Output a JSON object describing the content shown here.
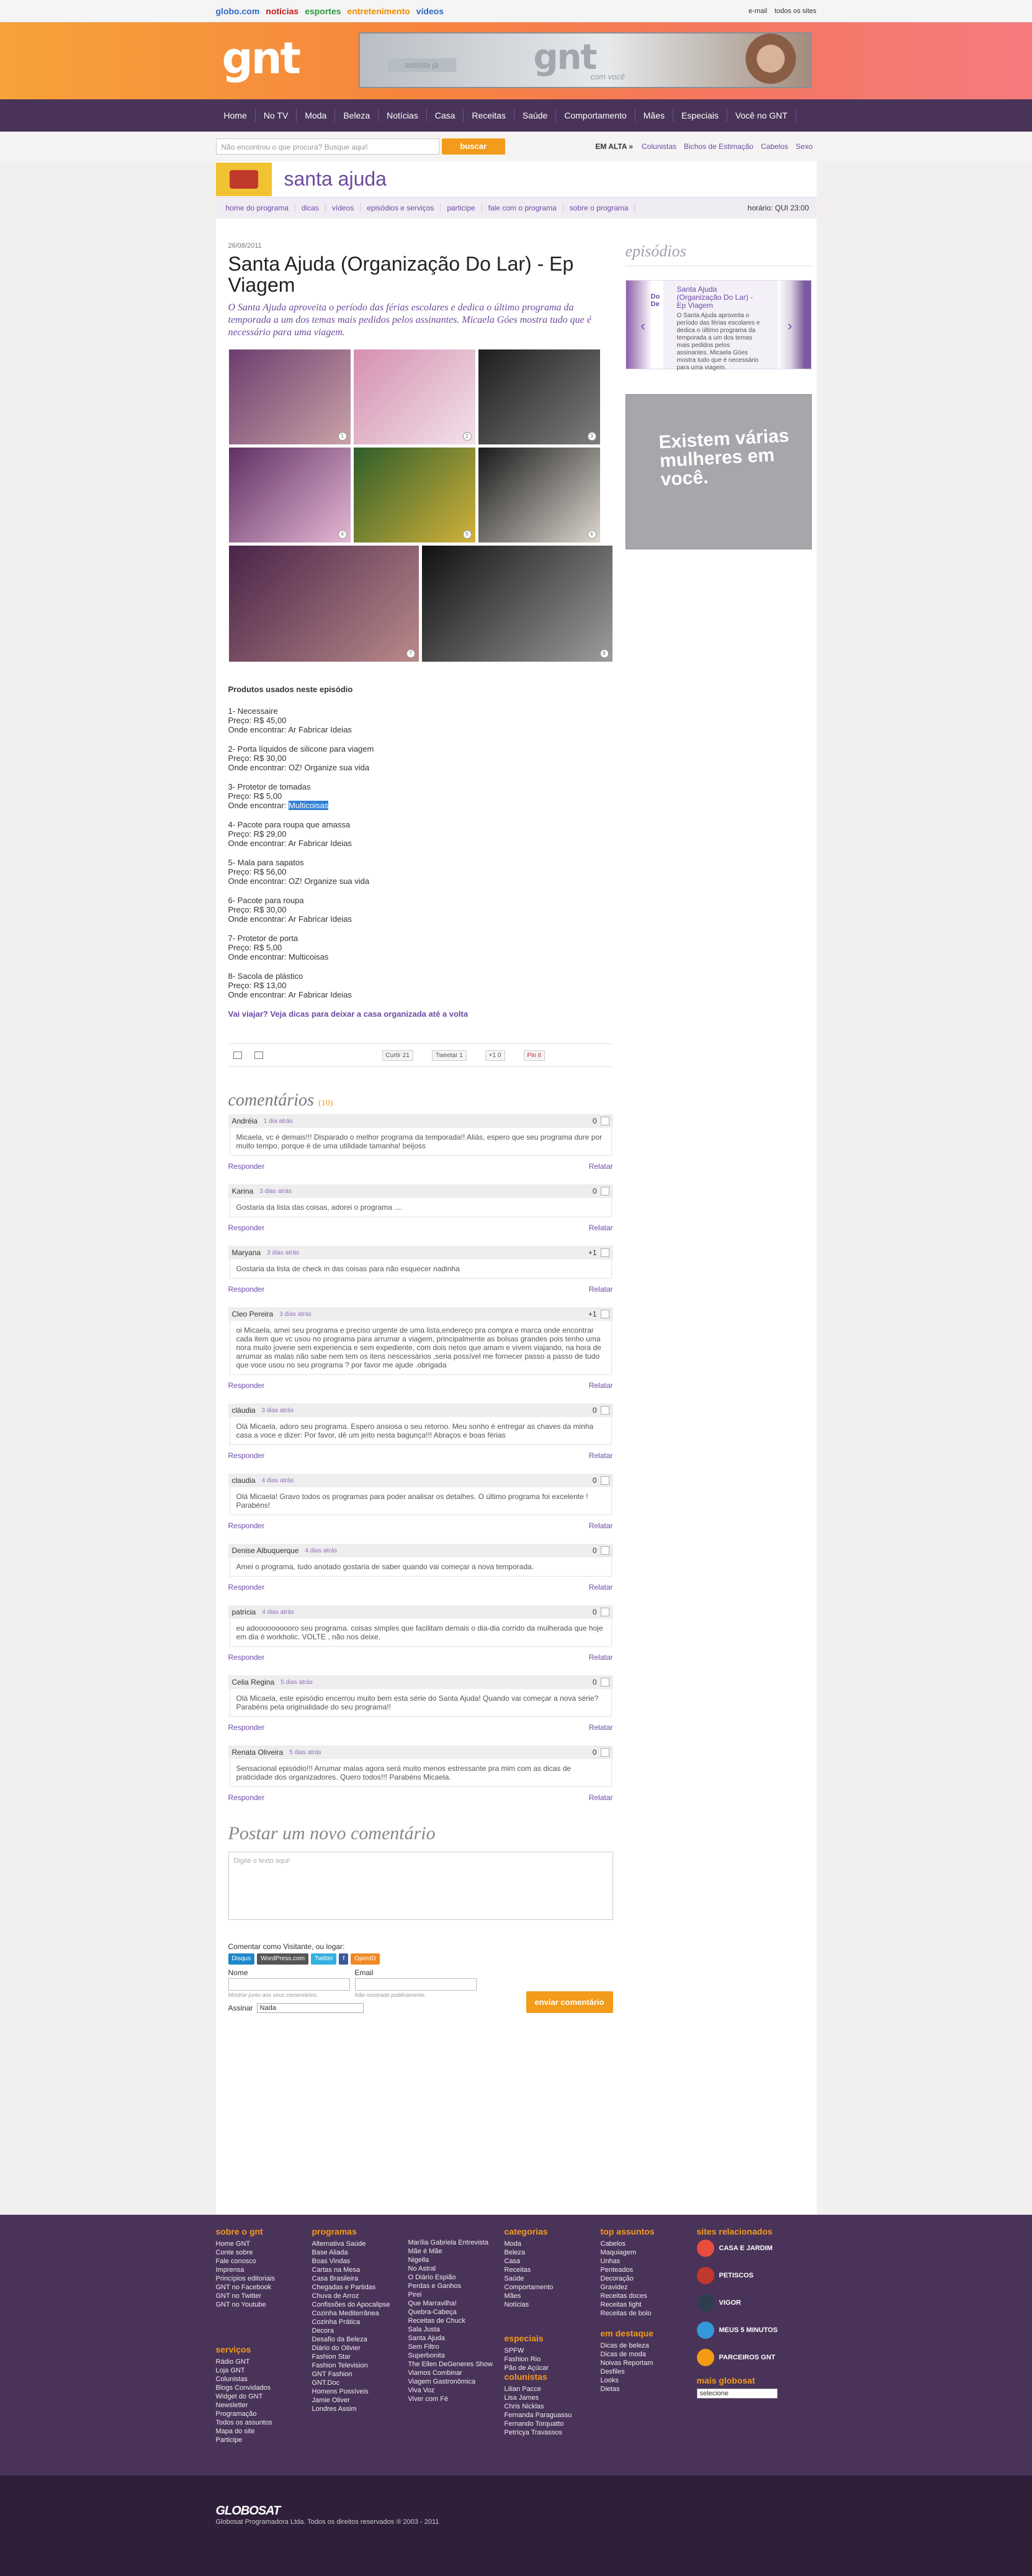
{
  "topbar": {
    "links": [
      "globo.com",
      "notícias",
      "esportes",
      "entretenimento",
      "vídeos"
    ],
    "colors": [
      "#2d69c8",
      "#c41a1a",
      "#2a9a3a",
      "#f08a00",
      "#2d69c8"
    ],
    "email": "e-mail",
    "todos": "todos os sites"
  },
  "header": {
    "logo": "gnt",
    "banner_label": "assista já",
    "banner_logo": "gnt",
    "banner_sub": "com você"
  },
  "nav": [
    "Home",
    "No TV",
    "Moda",
    "Beleza",
    "Notícias",
    "Casa",
    "Receitas",
    "Saúde",
    "Comportamento",
    "Mães",
    "Especiais",
    "Você no GNT"
  ],
  "search": {
    "placeholder": "Não encontrou o que procura? Busque aqui!",
    "button": "buscar",
    "emalta": "EM ALTA »",
    "links": [
      "Colunistas",
      "Bichos de Estimação",
      "Cabelos",
      "Sexo"
    ]
  },
  "program": {
    "title": "santa ajuda",
    "subnav": [
      "home do programa",
      "dicas",
      "vídeos",
      "episódios e serviços",
      "participe",
      "fale com o programa",
      "sobre o programa"
    ],
    "horario": "horário: QUI 23:00"
  },
  "article": {
    "date": "26/08/2011",
    "title": "Santa Ajuda (Organização Do Lar) - Ep Viagem",
    "lead": "O Santa Ajuda aproveita o período das férias escolares e dedica o último programa da temporada a um dos temas mais pedidos pelos assinantes. Micaela Góes mostra tudo que é necessário para uma viagem."
  },
  "photos": [
    "1",
    "2",
    "3",
    "4",
    "5",
    "6",
    "7",
    "8"
  ],
  "products": {
    "title": "Produtos usados neste episódio",
    "items": [
      {
        "name": "1- Necessaire",
        "price": "Preço: R$ 45,00",
        "where": "Onde encontrar: Ar Fabricar Ideias"
      },
      {
        "name": "2- Porta líquidos de silicone para viagem",
        "price": "Preço: R$ 30,00",
        "where": "Onde encontrar: OZ! Organize sua vida"
      },
      {
        "name": "3- Protetor de tomadas",
        "price": "Preço: R$ 5,00",
        "where": "Onde encontrar: ",
        "hl": "Multicoisas"
      },
      {
        "name": "4- Pacote para roupa que amassa",
        "price": "Preço: R$ 29,00",
        "where": "Onde encontrar: Ar Fabricar Ideias"
      },
      {
        "name": "5- Mala para sapatos",
        "price": "Preço: R$ 56,00",
        "where": "Onde encontrar: OZ! Organize sua vida"
      },
      {
        "name": "6- Pacote para roupa",
        "price": "Preço: R$ 30,00",
        "where": "Onde encontrar: Ar Fabricar Ideias"
      },
      {
        "name": "7- Protetor de porta",
        "price": "Preço: R$ 5,00",
        "where": "Onde encontrar: Multicoisas"
      },
      {
        "name": "8- Sacola de plástico",
        "price": "Preço: R$ 13,00",
        "where": "Onde encontrar: Ar Fabricar Ideias"
      }
    ],
    "travel": "Vai viajar? Veja dicas para deixar a casa organizada até a volta"
  },
  "share": {
    "curtir": "Curtir",
    "curtir_n": "21",
    "tweet": "Tweetar",
    "tweet_n": "1",
    "plus": "+1",
    "plus_n": "0",
    "pin": "Pin it"
  },
  "comments": {
    "title": "comentários",
    "count": "(10)",
    "reply": "Responder",
    "report": "Relatar",
    "items": [
      {
        "user": "Andréia",
        "time": "1 dia atrás",
        "score": "0",
        "text": "Micaela, vc é demais!!! Disparado o melhor programa da temporada!! Aliás, espero que seu programa dure por muito tempo, porque é de uma utilidade tamanha! beijoss"
      },
      {
        "user": "Karina",
        "time": "3 dias atrás",
        "score": "0",
        "text": "Gostaria da lista das coisas, adorei o programa ...."
      },
      {
        "user": "Maryana",
        "time": "3 dias atrás",
        "score": "+1",
        "text": "Gostaria da lista de check in das coisas para não esquecer nadinha"
      },
      {
        "user": "Cleo Pereira",
        "time": "3 dias atrás",
        "score": "+1",
        "text": "oi Micaela, amei seu programa e preciso urgente de uma lista,endereço pra compra e marca onde encontrar cada item que vc usou no programa para arrumar a viagem, principalmente as bolsas grandes pois tenho uma nora muito jovene sem experiencia e sem expediente, com dois netos que amam e vivem viajando, na hora de arrumar as malas não sabe nem tem os itens nescessários ,seria possível me fornecer passo a passo de tudo que voce usou no seu programa ? por favor me ajude .obrigada"
      },
      {
        "user": "cláudia",
        "time": "3 dias atrás",
        "score": "0",
        "text": "Olá Micaela, adoro seu programa. Espero ansiosa o seu retorno. Meu sonho é entregar as chaves da minha casa a voce e dizer: Por favor, dê um jeito nesta bagunça!!! Abraços e boas férias"
      },
      {
        "user": "claudia",
        "time": "4 dias atrás",
        "score": "0",
        "text": "Olá Micaela! Gravo todos os programas para poder analisar os detalhes. O último programa foi excelente ! Parabéns!"
      },
      {
        "user": "Denise Albuquerque",
        "time": "4 dias atrás",
        "score": "0",
        "text": "Amei o programa, tudo anotado gostaria de saber quando vai começar a nova temporada."
      },
      {
        "user": "patricia",
        "time": "4 dias atrás",
        "score": "0",
        "text": "eu adoooooooooro seu programa. coisas simples que facilitam demais o dia-dia corrido da mulherada que hoje em dia é workholic. VOLTE , não nos deixe."
      },
      {
        "user": "Celia Regina",
        "time": "5 dias atrás",
        "score": "0",
        "text": "Olá Micaela, este episódio encerrou muito bem esta série do Santa Ajuda! Quando vai começar a nova série? Parabéns pela originalidade do seu programa!!"
      },
      {
        "user": "Renata Oliveira",
        "time": "5 dias atrás",
        "score": "0",
        "text": "Sensacional episódio!!! Arrumar malas agora será muito menos estressante pra mim com as dicas de praticidade dos organizadores. Quero todos!!! Parabéns Micaela."
      }
    ]
  },
  "form": {
    "title": "Postar um novo comentário",
    "placeholder": "Digite o texto aqui!",
    "ident": "Comentar como Visitante, ou logar:",
    "services": [
      "Disqus",
      "WordPress.com",
      "Twitter",
      "f",
      "OpenID"
    ],
    "nome": "Nome",
    "nome_h": "Mostrar junto aos seus comentários.",
    "email": "Email",
    "email_h": "Não mostrado publicamente.",
    "assinar": "Assinar",
    "assinar_val": "Nada",
    "send": "enviar comentário"
  },
  "sidebar": {
    "episodios": "episódios",
    "ep_title": "Santa Ajuda (Organização Do Lar) - Ep Viagem",
    "ep_text": "O Santa Ajuda aproveita o período das férias escolares e dedica o último programa da temporada a um dos temas mais pedidos pelos assinantes. Micaela Góes mostra tudo que é necessário para uma viagem.",
    "ep_prev": "Do De",
    "ad": "Existem várias mulheres em você."
  },
  "footer": {
    "sobre": {
      "title": "sobre o gnt",
      "items": [
        "Home GNT",
        "Conte sobre",
        "Fale conosco",
        "Imprensa",
        "Princípios editoriais",
        "GNT no Facebook",
        "GNT no Twitter",
        "GNT no Youtube"
      ]
    },
    "servicos": {
      "title": "serviços",
      "items": [
        "Rádio GNT",
        "Loja GNT",
        "Colunistas",
        "Blogs Convidados",
        "Widget do GNT",
        "Newsletter",
        "Programação",
        "Todos os assuntos",
        "Mapa do site",
        "Participe"
      ]
    },
    "programas": {
      "title": "programas",
      "items": [
        "Alternativa Saúde",
        "Base Aliada",
        "Boas Vindas",
        "Cartas na Mesa",
        "Casa Brasileira",
        "Chegadas e Partidas",
        "Chuva de Arroz",
        "Confissões do Apocalipse",
        "Cozinha Mediterrânea",
        "Cozinha Prática",
        "Decora",
        "Desafio da Beleza",
        "Diário do Olivier",
        "Fashion Star",
        "Fashion Television",
        "GNT Fashion",
        "GNT.Doc",
        "Homens Possíveis",
        "Jamie Oliver",
        "Londres Assim"
      ]
    },
    "programas2": {
      "items": [
        "Marília Gabriela Entrevista",
        "Mãe é Mãe",
        "Nigella",
        "No Astral",
        "O Diário Espião",
        "Perdas e Ganhos",
        "Pirei",
        "Que Marravilha!",
        "Quebra-Cabeça",
        "Receitas de Chuck",
        "Sala Justa",
        "Santa Ajuda",
        "Sem Filtro",
        "Superbonita",
        "The Ellen DeGeneres Show",
        "Viamos Combinar",
        "Viagem Gastronômica",
        "Viva Voz",
        "Viver com Fé"
      ]
    },
    "categorias": {
      "title": "categorias",
      "items": [
        "Moda",
        "Beleza",
        "Casa",
        "Receitas",
        "Saúde",
        "Comportamento",
        "Mães",
        "Notícias"
      ]
    },
    "especiais": {
      "title": "especiais",
      "items": [
        "SPFW",
        "Fashion Rio",
        "Pão de Açúcar"
      ]
    },
    "colunistas": {
      "title": "colunistas",
      "items": [
        "Lilian Pacce",
        "Lisa James",
        "Chris Nicklas",
        "Fernanda Paraguassu",
        "Fernando Torquatto",
        "Petrícya Travassos"
      ]
    },
    "top": {
      "title": "top assuntos",
      "items": [
        "Cabelos",
        "Maquiagem",
        "Unhas",
        "Penteados",
        "Decoração",
        "Gravidez",
        "Receitas doces",
        "Receitas light",
        "Receitas de bolo"
      ]
    },
    "destaque": {
      "title": "em destaque",
      "items": [
        "Dicas de beleza",
        "Dicas de moda",
        "Noivas Reportam",
        "Desfiles",
        "Looks",
        "Dietas"
      ]
    },
    "rel": {
      "title": "sites relacionados",
      "items": [
        "CASA E JARDIM",
        "PETISCOS",
        "VIGOR",
        "MEUS 5 MINUTOS",
        "PARCEIROS GNT"
      ]
    },
    "mais": {
      "title": "mais globosat",
      "select": "selecione"
    }
  },
  "bottom": {
    "brand": "GLOBOSAT",
    "copy": "Globosat Programadora Ltda. Todos os direitos reservados ® 2003 - 2011"
  }
}
